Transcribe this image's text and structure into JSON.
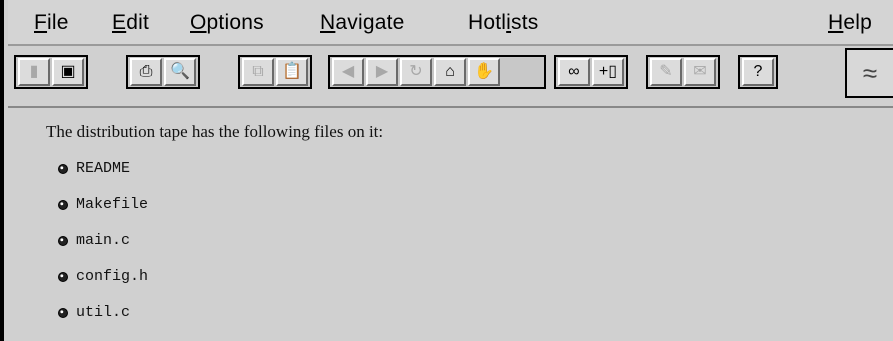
{
  "menu": {
    "file": {
      "mnemonic": "F",
      "rest": "ile"
    },
    "edit": {
      "mnemonic": "E",
      "rest": "dit"
    },
    "options": {
      "mnemonic": "O",
      "rest": "ptions"
    },
    "navigate": {
      "mnemonic": "N",
      "rest": "avigate"
    },
    "hotlists": {
      "pre": "Hotl",
      "mnemonic": "i",
      "rest": "sts"
    },
    "help": {
      "mnemonic": "H",
      "rest": "elp"
    }
  },
  "toolbar": {
    "icons": {
      "open": "folder-icon",
      "save": "floppy-disk-icon",
      "print": "printer-icon",
      "preview": "print-preview-icon",
      "copy": "copy-icon",
      "paste": "paste-icon",
      "back": "back-arrow-icon",
      "forward": "forward-arrow-icon",
      "reload": "reload-icon",
      "home": "home-icon",
      "stop": "stop-hand-icon",
      "find": "binoculars-icon",
      "add_hotlist": "add-to-hotlist-icon",
      "annotate": "annotate-icon",
      "mail": "mail-icon",
      "help": "help-icon",
      "logo": "globe-logo-icon"
    }
  },
  "content": {
    "intro": "The distribution tape has the following files on it:",
    "files": [
      "README",
      "Makefile",
      "main.c",
      "config.h",
      "util.c"
    ]
  }
}
